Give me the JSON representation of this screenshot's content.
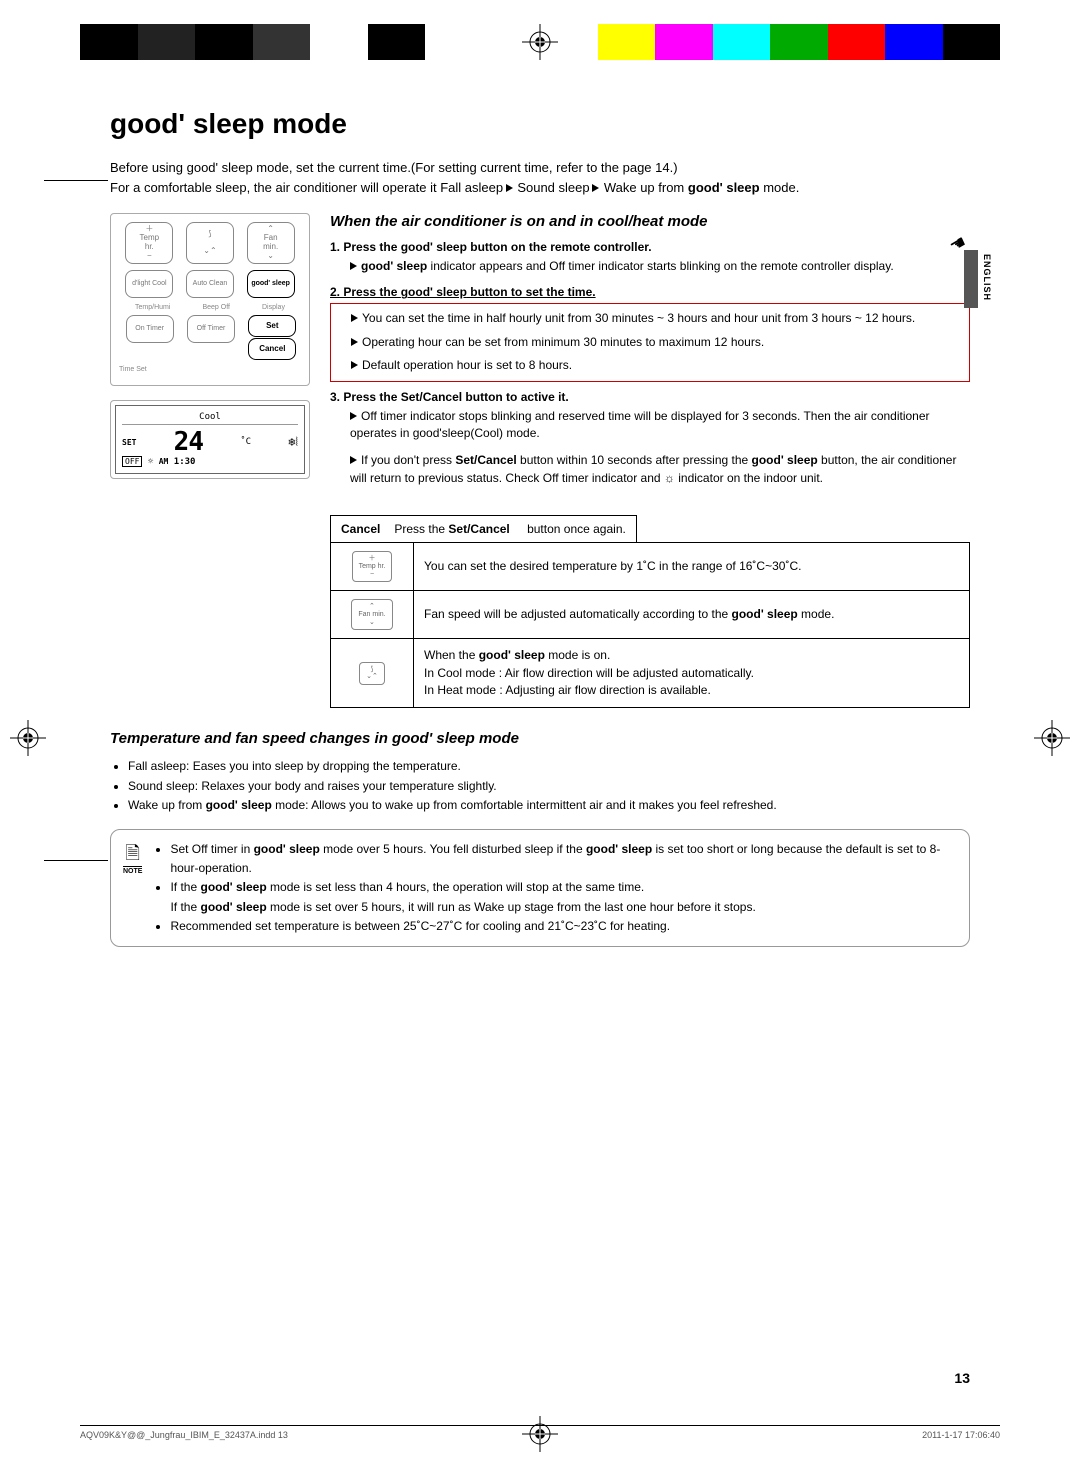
{
  "title_prefix": "good' sleep",
  "title_suffix": " mode",
  "intro_l1": "Before using good' sleep mode, set the current time.(For setting current time, refer to the page 14.)",
  "intro_l2_a": "For a comfortable sleep, the air conditioner will operate it Fall asleep ",
  "intro_l2_b": " Sound sleep ",
  "intro_l2_c": " Wake up from ",
  "intro_l2_bold": "good' sleep",
  "intro_l2_end": " mode.",
  "lang": "ENGLISH",
  "section1_h": "When the air conditioner is on and in cool/heat mode",
  "step1_a": "1.   Press the ",
  "step1_bold": "good' sleep",
  "step1_b": " button on the remote controller.",
  "step1_sub_bold": "good' sleep",
  "step1_sub": " indicator appears and Off timer indicator starts blinking on the remote controller display.",
  "step2_a": "2.   Press the ",
  "step2_bold": "good' sleep",
  "step2_b": " button to set the time.",
  "step2_sub1": "You can set the time in half hourly unit from 30 minutes ~ 3 hours and hour unit from 3 hours ~ 12 hours.",
  "step2_sub2": "Operating hour can be set from minimum 30 minutes to maximum 12 hours.",
  "step2_sub3": "Default operation hour is set to 8 hours.",
  "step3_a": "3.   Press the ",
  "step3_bold": "Set/Cancel",
  "step3_b": " button to active it.",
  "step3_sub1": "Off timer indicator stops blinking and reserved time will be displayed for 3 seconds. Then the air conditioner operates in good'sleep(Cool) mode.",
  "step3_sub2_a": "If you don't press ",
  "step3_sub2_bold1": "Set/Cancel",
  "step3_sub2_b": " button within 10 seconds after pressing the ",
  "step3_sub2_bold2": "good' sleep",
  "step3_sub2_c": " button, the air conditioner will return to previous status.  Check Off timer indicator and ",
  "step3_sub2_d": " indicator on the indoor unit.",
  "cancel_lbl": "Cancel",
  "cancel_txt_a": "Press the ",
  "cancel_txt_bold": "Set/Cancel",
  "cancel_txt_b": " button once again.",
  "tbl_r1": "You can set the desired temperature by 1˚C in the range of 16˚C~30˚C.",
  "tbl_r2_a": "Fan speed will be adjusted automatically according to the ",
  "tbl_r2_bold": "good' sleep",
  "tbl_r2_b": " mode.",
  "tbl_r3_l1_a": "When the ",
  "tbl_r3_l1_bold": "good' sleep",
  "tbl_r3_l1_b": " mode is on.",
  "tbl_r3_l2": "In Cool mode : Air flow direction will be adjusted automatically.",
  "tbl_r3_l3": "In Heat mode : Adjusting air flow direction is available.",
  "section2_h_a": "Temperature and fan speed changes in ",
  "section2_h_bold": "good' sleep",
  "section2_h_b": " mode",
  "bul1": "Fall asleep: Eases you into sleep by dropping the temperature.",
  "bul2": "Sound sleep: Relaxes your body and raises your temperature slightly.",
  "bul3_a": "Wake up from ",
  "bul3_bold": "good' sleep",
  "bul3_b": " mode: Allows you to wake up from comfortable intermittent air and it makes you feel refreshed.",
  "note_lbl": "NOTE",
  "note1_a": "Set Off timer in ",
  "note1_bold1": "good' sleep",
  "note1_b": " mode over 5 hours. You fell disturbed sleep if the ",
  "note1_bold2": "good' sleep",
  "note1_c": " is set too short or long because the default is set to 8-hour-operation.",
  "note2_a": "If the ",
  "note2_bold": "good' sleep",
  "note2_b": " mode is set less than 4 hours, the operation will stop at the same time.",
  "note2_l2_a": "If the ",
  "note2_l2_bold": "good' sleep",
  "note2_l2_b": " mode is set over 5 hours, it will run as Wake up stage from the last one hour before it stops.",
  "note3": "Recommended set temperature is between 25˚C~27˚C for cooling and 21˚C~23˚C for heating.",
  "page_num": "13",
  "footer_l": "AQV09K&Y@@_Jungfrau_IBIM_E_32437A.indd   13",
  "footer_r": "2011-1-17   17:06:40",
  "remote": {
    "temp": "Temp",
    "hr": "hr.",
    "fan": "Fan",
    "min": "min.",
    "dlight": "d'light Cool",
    "auto": "Auto Clean",
    "good": "good' sleep",
    "temphumi": "Temp/Humi",
    "beep": "Beep Off",
    "disp": "Display",
    "on": "On Timer",
    "off": "Off Timer",
    "set": "Set",
    "cancel": "Cancel",
    "timeset": "Time Set"
  },
  "lcd": {
    "mode": "Cool",
    "set": "SET",
    "temp": "24",
    "unit": "˚C",
    "off": "OFF",
    "ampm": "AM",
    "time": "1:30"
  },
  "icons": {
    "temp": "Temp hr.",
    "fan": "Fan min."
  },
  "colors": [
    "#000",
    "#000",
    "#000",
    "#000",
    "#fff",
    "#000",
    "#fff",
    "#fff",
    "#fff",
    "#ff0",
    "#f0f",
    "#0ff",
    "#0a0",
    "#f00",
    "#00f",
    "#000"
  ]
}
